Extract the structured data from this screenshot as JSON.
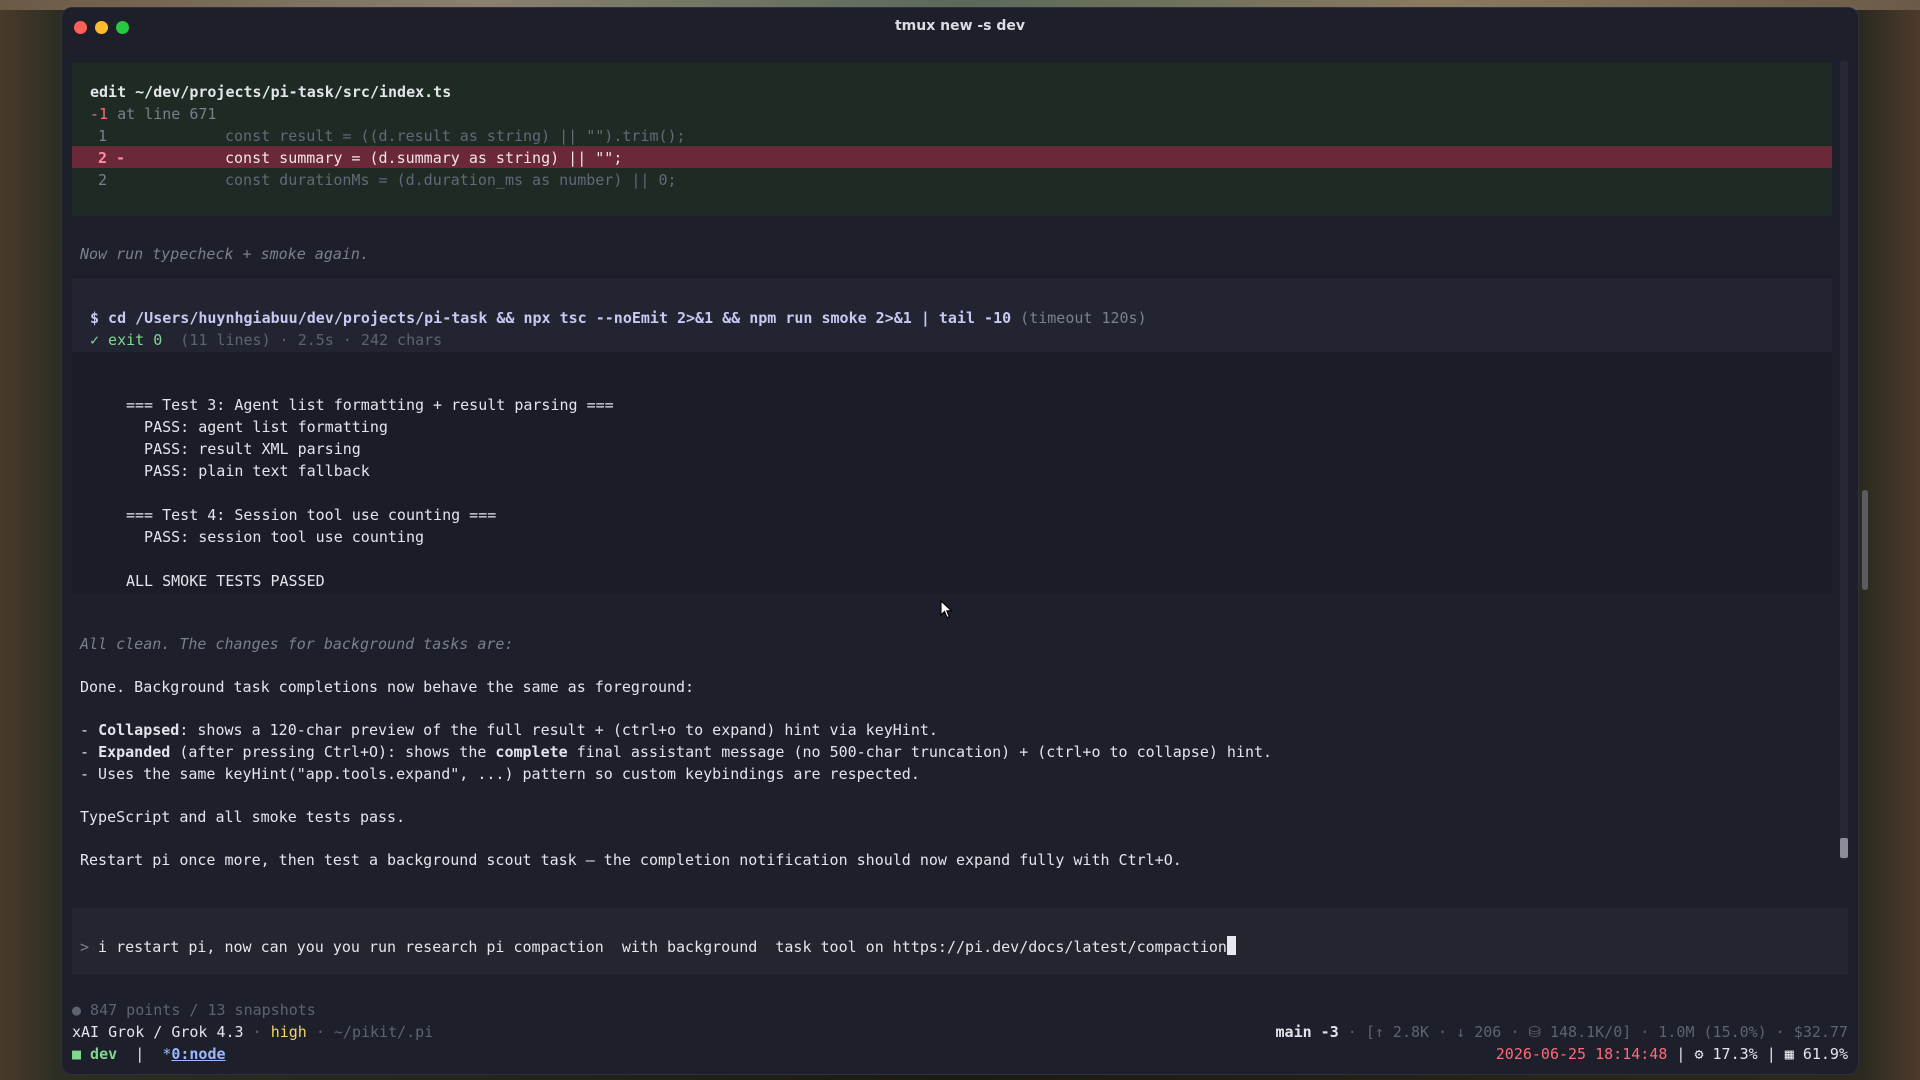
{
  "window": {
    "title": "tmux new -s dev"
  },
  "edit": {
    "header_cmd": "edit",
    "header_path": " ~/dev/projects/pi-task/src/index.ts",
    "diff_stat": "-1",
    "diff_loc": " at line 671",
    "lines": [
      {
        "num": "1",
        "marker": "  ",
        "code": "const result = ((d.result as string) || \"\").trim();"
      },
      {
        "num": "2",
        "marker": " -",
        "code": "const summary = (d.summary as string) || \"\";"
      },
      {
        "num": "2",
        "marker": "  ",
        "code": "const durationMs = (d.duration_ms as number) || 0;"
      }
    ]
  },
  "note1": "Now run typecheck + smoke again.",
  "bash": {
    "command": "$ cd /Users/huynhgiabuu/dev/projects/pi-task && npx tsc --noEmit 2>&1 && npm run smoke 2>&1 | tail -10",
    "timeout": " (timeout 120s)",
    "exit": "✓ exit 0",
    "meta": "  (11 lines) · 2.5s · 242 chars",
    "output": [
      "=== Test 3: Agent list formatting + result parsing ===",
      "  PASS: agent list formatting",
      "  PASS: result XML parsing",
      "  PASS: plain text fallback",
      "",
      "=== Test 4: Session tool use counting ===",
      "  PASS: session tool use counting",
      "",
      "ALL SMOKE TESTS PASSED"
    ]
  },
  "note2": "All clean. The changes for background tasks are:",
  "summary": {
    "intro": "Done. Background task completions now behave the same as foreground:",
    "b1_pre": "- ",
    "b1_bold": "Collapsed",
    "b1_rest": ": shows a 120-char preview of the full result + (ctrl+o to expand) hint via keyHint.",
    "b2_pre": "- ",
    "b2_bold": "Expanded",
    "b2_mid": " (after pressing Ctrl+O): shows the ",
    "b2_bold2": "complete",
    "b2_rest": " final assistant message (no 500-char truncation) + (ctrl+o to collapse) hint.",
    "b3": "- Uses the same keyHint(\"app.tools.expand\", ...) pattern so custom keybindings are respected.",
    "p2": "TypeScript and all smoke tests pass.",
    "p3": "Restart pi once more, then test a background scout task — the completion notification should now expand fully with Ctrl+O."
  },
  "prompt": {
    "symbol": ">",
    "text": " i restart pi, now can you you run research pi compaction  with background  task tool on https://pi.dev/docs/latest/compaction"
  },
  "status": {
    "points": "● 847 points / 13 snapshots",
    "model": "xAI Grok / Grok 4.3",
    "sep": " · ",
    "thinking": "high",
    "cwd": " · ~/pikit/.pi",
    "branch": "main -3",
    "stats": " · [↑ 2.8K · ↓ 206 · ⛁ 148.1K/0] · 1.0M (15.0%) · $32.77",
    "session_marker": "■",
    "session": " dev",
    "pipe": "  |  ",
    "win_star": "*",
    "win": "0:node",
    "datetime": "2026-06-25 18:14:48",
    "pipe2": " | ",
    "cpu_icon": "⚙",
    "cpu": " 17.3%",
    "pipe3": " | ",
    "mem_icon": "▦",
    "mem": " 61.9%"
  }
}
